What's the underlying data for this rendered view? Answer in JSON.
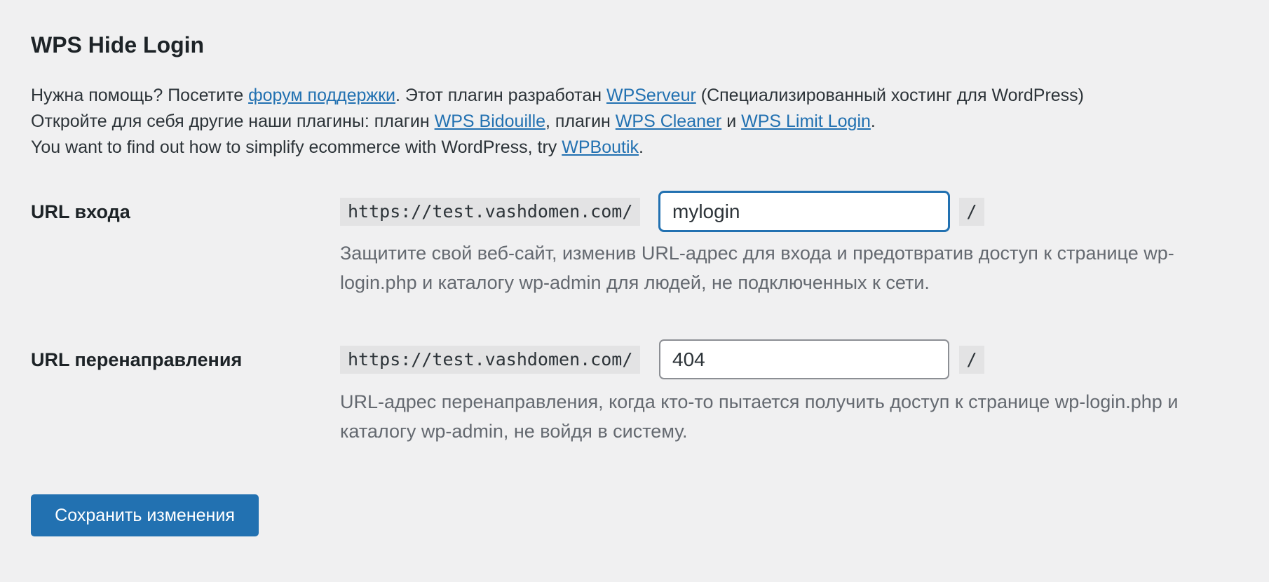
{
  "page": {
    "title": "WPS Hide Login"
  },
  "intro": {
    "line1_text1": "Нужна помощь? Посетите ",
    "line1_link1": "форум поддержки",
    "line1_text2": ". Этот плагин разработан ",
    "line1_link2": "WPServeur",
    "line1_text3": " (Специализированный хостинг для WordPress)",
    "line2_text1": "Откройте для себя другие наши плагины: плагин ",
    "line2_link1": "WPS Bidouille",
    "line2_text2": ", плагин ",
    "line2_link2": "WPS Cleaner",
    "line2_text3": " и ",
    "line2_link3": "WPS Limit Login",
    "line2_text4": ".",
    "line3_text1": "You want to find out how to simplify ecommerce with WordPress, try ",
    "line3_link1": "WPBoutik",
    "line3_text2": "."
  },
  "login_url": {
    "label": "URL входа",
    "prefix": "https://test.vashdomen.com/",
    "value": "mylogin",
    "suffix": "/",
    "description": "Защитите свой веб-сайт, изменив URL-адрес для входа и предотвратив доступ к странице wp-login.php и каталогу wp-admin для людей, не подключенных к сети."
  },
  "redirect_url": {
    "label": "URL перенаправления",
    "prefix": "https://test.vashdomen.com/",
    "value": "404",
    "suffix": "/",
    "description": "URL-адрес перенаправления, когда кто-то пытается получить доступ к странице wp-login.php и каталогу wp-admin, не войдя в систему."
  },
  "actions": {
    "save_label": "Сохранить изменения"
  },
  "colors": {
    "background": "#f0f0f1",
    "link": "#2271b1",
    "primary_button": "#2271b1",
    "description_text": "#646970"
  }
}
